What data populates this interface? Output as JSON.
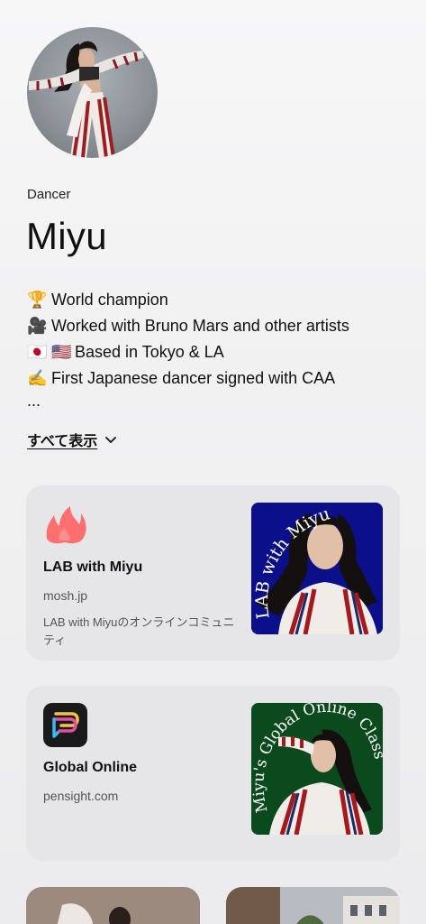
{
  "profile": {
    "role": "Dancer",
    "name": "Miyu",
    "bio": [
      {
        "icon": "🏆",
        "text": "World champion"
      },
      {
        "icon": "🎥",
        "text": "Worked with Bruno Mars and other artists"
      },
      {
        "icon": "🇯🇵 🇺🇸",
        "text": "Based in Tokyo & LA"
      },
      {
        "icon": "✍️",
        "text": "First Japanese dancer signed with CAA"
      }
    ],
    "bio_more": "...",
    "show_all_label": "すべて表示"
  },
  "links": [
    {
      "title": "LAB with Miyu",
      "domain": "mosh.jp",
      "description": "LAB with Miyuのオンラインコミュニティ",
      "logo_icon": "flame-logo-icon",
      "logo_color": "#ff6b6b",
      "thumb_text": "LAB with Miyu",
      "thumb_bg": "#0b0f8a"
    },
    {
      "title": "Global Online",
      "domain": "pensight.com",
      "description": "",
      "logo_icon": "speech-bubble-logo-icon",
      "logo_color": "#1a1a1a",
      "thumb_text": "Miyu's Global Online Class",
      "thumb_bg": "#0b4a1c"
    }
  ]
}
